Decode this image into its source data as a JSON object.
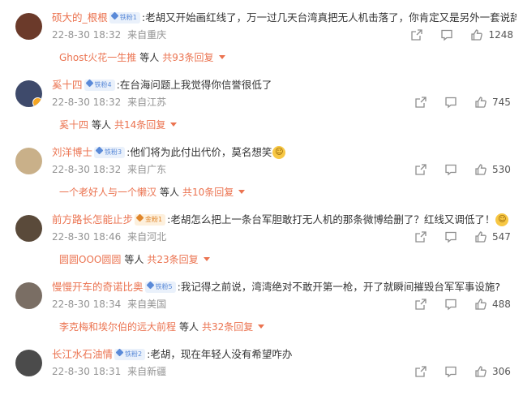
{
  "comments": [
    {
      "user": "硕大的_根根",
      "badge": "铁粉1",
      "badge_style": "blue",
      "text": "老胡又开始画红线了，万一过几天台湾真把无人机击落了，你肯定又是另外一套说辞",
      "emoji": "",
      "time": "22-8-30 18:32",
      "location": "来自重庆",
      "likes": "1248",
      "reply_user": "Ghost火花一生推",
      "reply_etc": "等人",
      "reply_count": "共93条回复",
      "avatar_color": "#6b3a2a"
    },
    {
      "user": "奚十四",
      "badge": "铁粉4",
      "badge_style": "blue",
      "text": "在台海问题上我觉得你信誉很低了",
      "emoji": "",
      "time": "22-8-30 18:32",
      "location": "来自江苏",
      "likes": "745",
      "reply_user": "奚十四",
      "reply_etc": "等人",
      "reply_count": "共14条回复",
      "avatar_color": "#3e4a6b"
    },
    {
      "user": "刘洋博士",
      "badge": "铁粉3",
      "badge_style": "blue",
      "text": "他们将为此付出代价，莫名想笑",
      "emoji": "laugh-emoji",
      "time": "22-8-30 18:32",
      "location": "来自广东",
      "likes": "530",
      "reply_user": "一个老好人与一个懒汉",
      "reply_etc": "等人",
      "reply_count": "共10条回复",
      "avatar_color": "#c9b089"
    },
    {
      "user": "前方路长怎能止步",
      "badge": "金粉1",
      "badge_style": "gold",
      "text": "老胡怎么把上一条台军胆敢打无人机的那条微博给删了？红线又调低了！",
      "emoji": "cry-laugh-emoji",
      "time": "22-8-30 18:46",
      "location": "来自河北",
      "likes": "547",
      "reply_user": "圆圆OOO圆圆",
      "reply_etc": "等人",
      "reply_count": "共23条回复",
      "avatar_color": "#5a4a3a"
    },
    {
      "user": "慢慢开车的奇诺比奥",
      "badge": "铁粉5",
      "badge_style": "blue",
      "text": "我记得之前说，湾湾绝对不敢开第一枪，开了就瞬间摧毁台军军事设施?",
      "emoji": "",
      "time": "22-8-30 18:34",
      "location": "来自美国",
      "likes": "488",
      "reply_user": "李克梅和埃尔伯的远大前程",
      "reply_etc": "等人",
      "reply_count": "共32条回复",
      "avatar_color": "#7a6e64"
    },
    {
      "user": "长江水石油情",
      "badge": "铁粉2",
      "badge_style": "blue",
      "text": "老胡，现在年轻人没有希望咋办",
      "emoji": "",
      "time": "22-8-30 18:31",
      "location": "来自新疆",
      "likes": "306",
      "reply_user": "",
      "reply_etc": "",
      "reply_count": "",
      "avatar_color": "#4b4b4b"
    }
  ],
  "icons": {
    "share": "share-icon",
    "comment": "comment-icon",
    "like": "thumbs-up-icon",
    "more": "chevron-down-icon"
  },
  "colors": {
    "username": "#eb7350",
    "meta": "#939393",
    "icon": "#8d8d8d"
  }
}
